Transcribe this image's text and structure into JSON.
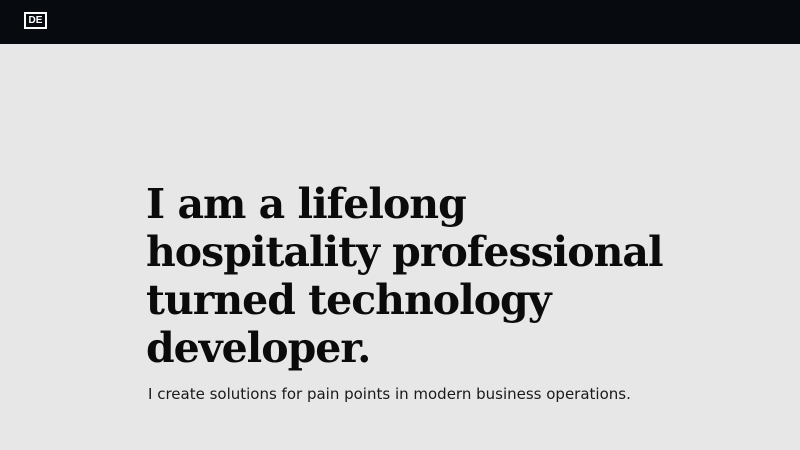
{
  "header": {
    "logo_text": "DE",
    "background": "#070b10"
  },
  "hero": {
    "headline_lines": [
      "I am a lifelong",
      "hospitality professional",
      "turned technology",
      "developer."
    ],
    "subline": "I create solutions for pain points in modern business operations."
  },
  "colors": {
    "page_background": "#e6e7e6",
    "text": "#0b0b0b"
  }
}
